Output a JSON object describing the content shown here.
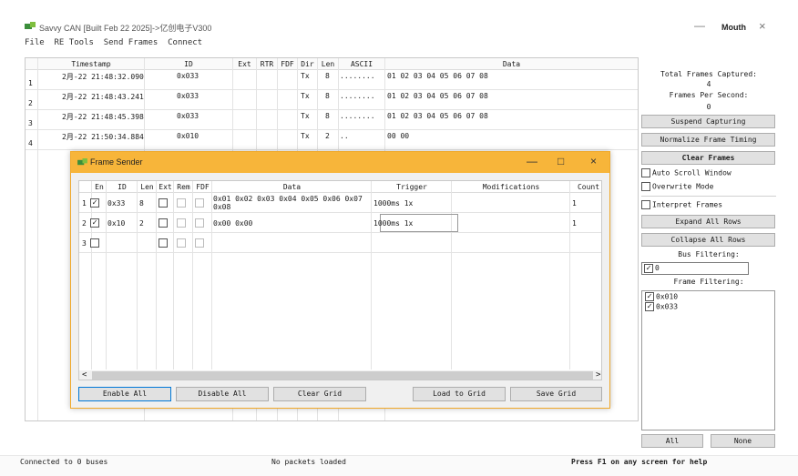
{
  "window": {
    "title": "Savvy CAN [Built Feb 22 2025]->亿创电子V300",
    "extra_label": "Mouth",
    "minimize_glyph": "—",
    "close_glyph": "×"
  },
  "menu": [
    "File",
    "RE Tools",
    "Send Frames",
    "Connect"
  ],
  "frames_grid": {
    "columns": [
      "Timestamp",
      "ID",
      "Ext",
      "RTR",
      "FDF",
      "Dir",
      "Len",
      "ASCII",
      "Data"
    ],
    "rows": [
      {
        "num": "1",
        "timestamp": "2月-22 21:48:32.090",
        "id": "0x033",
        "dir": "Tx",
        "len": "8",
        "ascii": "........",
        "data": "01 02 03 04 05 06 07 08"
      },
      {
        "num": "2",
        "timestamp": "2月-22 21:48:43.241",
        "id": "0x033",
        "dir": "Tx",
        "len": "8",
        "ascii": "........",
        "data": "01 02 03 04 05 06 07 08"
      },
      {
        "num": "3",
        "timestamp": "2月-22 21:48:45.398",
        "id": "0x033",
        "dir": "Tx",
        "len": "8",
        "ascii": "........",
        "data": "01 02 03 04 05 06 07 08"
      },
      {
        "num": "4",
        "timestamp": "2月-22 21:50:34.884",
        "id": "0x010",
        "dir": "Tx",
        "len": "2",
        "ascii": "..",
        "data": "00 00"
      }
    ]
  },
  "right_panel": {
    "total_frames_label": "Total Frames Captured:",
    "total_frames_value": "4",
    "fps_label": "Frames Per Second:",
    "fps_value": "0",
    "suspend_button": "Suspend Capturing",
    "normalize_button": "Normalize Frame Timing",
    "clear_button": "Clear Frames",
    "auto_scroll": {
      "label": "Auto Scroll Window",
      "checked": false
    },
    "overwrite": {
      "label": "Overwrite Mode",
      "checked": false
    },
    "interpret": {
      "label": "Interpret Frames",
      "checked": false
    },
    "expand_button": "Expand All Rows",
    "collapse_button": "Collapse All Rows",
    "bus_filtering_label": "Bus Filtering:",
    "bus_filter_value": "0",
    "frame_filtering_label": "Frame Filtering:",
    "frame_filters": [
      {
        "label": "0x010",
        "checked": true
      },
      {
        "label": "0x033",
        "checked": true
      }
    ],
    "all_button": "All",
    "none_button": "None"
  },
  "status": {
    "connection": "Connected to 0 buses",
    "packets": "No packets loaded",
    "help": "Press F1 on any screen for help"
  },
  "frame_sender": {
    "title": "Frame Sender",
    "minimize_glyph": "—",
    "maximize_glyph": "□",
    "close_glyph": "×",
    "columns": [
      "En",
      "ID",
      "Len",
      "Ext",
      "Rem",
      "FDF",
      "Data",
      "Trigger",
      "Modifications",
      "Count"
    ],
    "rows": [
      {
        "num": "1",
        "enabled": true,
        "id": "0x33",
        "len": "8",
        "data": "0x01 0x02 0x03 0x04 0x05 0x06 0x07",
        "data2": "0x08",
        "trigger": "1000ms 1x",
        "count": "1"
      },
      {
        "num": "2",
        "enabled": true,
        "id": "0x10",
        "len": "2",
        "data": "0x00 0x00",
        "data2": "",
        "trigger": "1000ms 1x",
        "count": "1"
      },
      {
        "num": "3",
        "enabled": false,
        "id": "",
        "len": "",
        "data": "",
        "data2": "",
        "trigger": "",
        "count": ""
      }
    ],
    "buttons": {
      "enable_all": "Enable All",
      "disable_all": "Disable All",
      "clear_grid": "Clear Grid",
      "load_grid": "Load to Grid",
      "save_grid": "Save Grid"
    },
    "scroll_left": "<",
    "scroll_right": ">"
  },
  "check_glyph": "✓",
  "colors": {
    "dialog_title": "#f7b53a",
    "focus_border": "#0078d7"
  }
}
